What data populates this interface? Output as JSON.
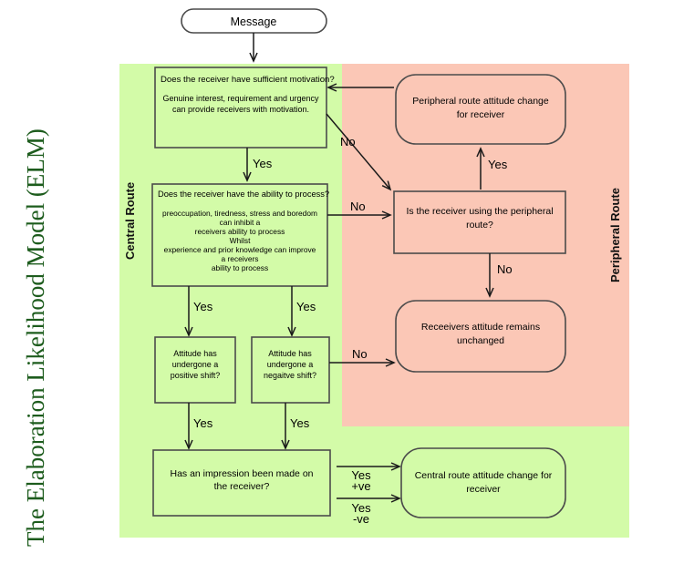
{
  "title": "The Elaboration Likelihood Model (ELM)",
  "lanes": [
    {
      "label": "Central Route",
      "color": "#d3fba8"
    },
    {
      "label": "Peripheral Route",
      "color": "#fbc7b6"
    }
  ],
  "nodes": {
    "message": {
      "label": "Message",
      "shape": "terminator",
      "fill": "#ffffff"
    },
    "motivation": {
      "line1": "Does the receiver have sufficient motivation?",
      "line2": "Genuine interest, requirement and urgency",
      "line3": "can provide receivers with motivation.",
      "shape": "process"
    },
    "ability": {
      "line1": "Does the receiver have the ability to process?",
      "line2": "preoccupation, tiredness, stress and boredom",
      "line3": "can inhibit a",
      "line4": "receivers ability to process",
      "line5": "Whilst",
      "line6": "experience and prior knowledge can improve",
      "line7": "a receivers",
      "line8": "ability to process",
      "shape": "process"
    },
    "positive_shift": {
      "line1": "Attitude has",
      "line2": "undergone a",
      "line3": "positive shift?",
      "shape": "process"
    },
    "negative_shift": {
      "line1": "Attitude has",
      "line2": "undergone a",
      "line3": "negaitve shift?",
      "shape": "process"
    },
    "impression": {
      "line1": "Has an impression been made on",
      "line2": "the receiver?",
      "shape": "process"
    },
    "central_change": {
      "line1": "Central route attitude change for",
      "line2": "receiver",
      "shape": "terminator"
    },
    "peripheral_change": {
      "line1": "Peripheral route attitude change",
      "line2": "for receiver",
      "shape": "terminator"
    },
    "peripheral_question": {
      "line1": "Is the receiver using the peripheral",
      "line2": "route?",
      "shape": "process"
    },
    "unchanged": {
      "line1": "Receeivers attitude remains",
      "line2": "unchanged",
      "shape": "terminator"
    }
  },
  "edges": {
    "motivation_yes": "Yes",
    "motivation_no": "No",
    "ability_no": "No",
    "ability_yes_left": "Yes",
    "ability_yes_right": "Yes",
    "positive_yes": "Yes",
    "negative_yes": "Yes",
    "negative_no": "No",
    "peripheral_yes": "Yes",
    "peripheral_no": "No",
    "impression_yes_pos_a": "Yes",
    "impression_yes_pos_b": "+ve",
    "impression_yes_neg_a": "Yes",
    "impression_yes_neg_b": "-ve"
  }
}
